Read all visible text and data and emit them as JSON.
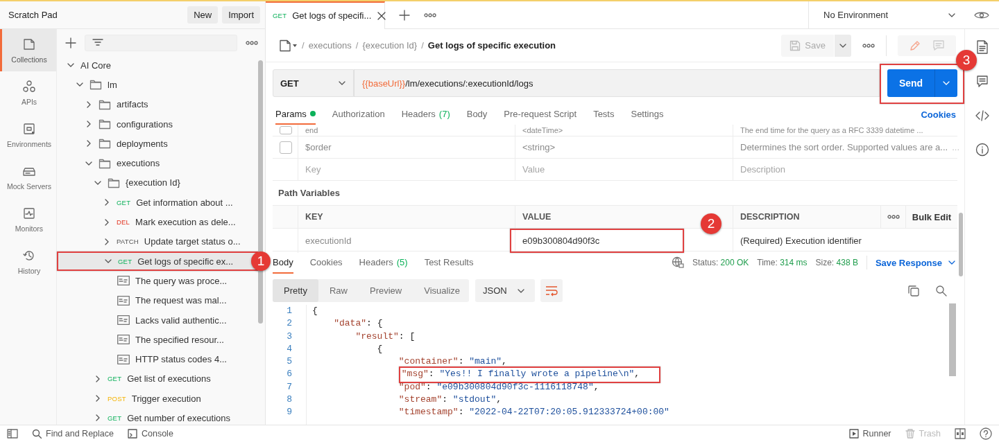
{
  "header": {
    "title": "Scratch Pad",
    "buttons": [
      "New",
      "Import"
    ]
  },
  "tabs": [
    {
      "method": "GET",
      "title": "Get logs of specifi...",
      "selected": true
    }
  ],
  "environment": {
    "value": "No Environment"
  },
  "nav": [
    {
      "label": "Collections",
      "selected": true
    },
    {
      "label": "APIs",
      "selected": false
    },
    {
      "label": "Environments",
      "selected": false
    },
    {
      "label": "Mock Servers",
      "selected": false
    },
    {
      "label": "Monitors",
      "selected": false
    },
    {
      "label": "History",
      "selected": false
    }
  ],
  "tree": [
    {
      "kind": "collection",
      "name": "AI Core",
      "expanded": true,
      "children": [
        {
          "kind": "folder",
          "name": "lm",
          "expanded": true,
          "children": [
            {
              "kind": "folder",
              "name": "artifacts",
              "expanded": false
            },
            {
              "kind": "folder",
              "name": "configurations",
              "expanded": false
            },
            {
              "kind": "folder",
              "name": "deployments",
              "expanded": false
            },
            {
              "kind": "folder",
              "name": "executions",
              "expanded": true,
              "children": [
                {
                  "kind": "folder",
                  "name": "{execution Id}",
                  "expanded": true,
                  "children": [
                    {
                      "kind": "request",
                      "method": "GET",
                      "name": "Get information about ...",
                      "expanded": false,
                      "selected": false
                    },
                    {
                      "kind": "request",
                      "method": "DEL",
                      "name": "Mark execution as dele...",
                      "expanded": false,
                      "selected": false
                    },
                    {
                      "kind": "request",
                      "method": "PATCH",
                      "name": "Update target status o...",
                      "expanded": false,
                      "selected": false
                    },
                    {
                      "kind": "request",
                      "method": "GET",
                      "name": "Get logs of specific ex...",
                      "expanded": true,
                      "selected": true,
                      "annotation": "1",
                      "children": [
                        {
                          "kind": "example",
                          "name": "The query was proce..."
                        },
                        {
                          "kind": "example",
                          "name": "The request was mal..."
                        },
                        {
                          "kind": "example",
                          "name": "Lacks valid authentic..."
                        },
                        {
                          "kind": "example",
                          "name": "The specified resour..."
                        },
                        {
                          "kind": "example",
                          "name": "HTTP status codes 4..."
                        }
                      ]
                    }
                  ]
                },
                {
                  "kind": "request",
                  "method": "GET",
                  "name": "Get list of executions",
                  "expanded": false,
                  "selected": false
                },
                {
                  "kind": "request",
                  "method": "POST",
                  "name": "Trigger execution",
                  "expanded": false,
                  "selected": false
                },
                {
                  "kind": "request",
                  "method": "GET",
                  "name": "Get number of executions",
                  "expanded": false,
                  "selected": false
                }
              ]
            }
          ]
        }
      ]
    }
  ],
  "request": {
    "breadcrumb": [
      {
        "kind": "separator",
        "text": "/"
      },
      {
        "kind": "link",
        "text": "executions"
      },
      {
        "kind": "separator",
        "text": "/"
      },
      {
        "kind": "link",
        "text": "{execution Id}"
      },
      {
        "kind": "separator",
        "text": "/"
      }
    ],
    "title": "Get logs of specific execution",
    "save_label": "Save",
    "method": "GET",
    "url": [
      {
        "text": "{{baseUrl}}",
        "kind": "variable"
      },
      {
        "text": "/lm/executions/:executionId/logs",
        "kind": "path"
      }
    ],
    "send": {
      "label": "Send",
      "annotation": "3"
    },
    "tabs": [
      {
        "label": "Params",
        "dot": true,
        "selected": true
      },
      {
        "label": "Authorization",
        "selected": false
      },
      {
        "label": "Headers",
        "count": "(7)",
        "selected": false
      },
      {
        "label": "Body",
        "selected": false
      },
      {
        "label": "Pre-request Script",
        "selected": false
      },
      {
        "label": "Tests",
        "selected": false
      },
      {
        "label": "Settings",
        "selected": false
      }
    ],
    "cookies_link": "Cookies"
  },
  "params": [
    {
      "kind": "param",
      "checked": false,
      "key": "end",
      "value": "<dateTime>",
      "description": "The end time for the query as a RFC 3339 datetime ..."
    },
    {
      "kind": "param",
      "checked": false,
      "key": "$order",
      "value": "<string>",
      "description": "Determines the sort order. Supported values are a...",
      "more": "..."
    },
    {
      "kind": "new",
      "key_placeholder": "Key",
      "value_placeholder": "Value",
      "description_placeholder": "Description"
    }
  ],
  "path_variables": {
    "title": "Path Variables",
    "columns": [
      "KEY",
      "VALUE",
      "DESCRIPTION"
    ],
    "bulk_edit": "Bulk Edit",
    "rows": [
      {
        "key": "executionId",
        "value": "e09b300804d90f3c",
        "description": "(Required) Execution identifier",
        "annotation": "2"
      }
    ]
  },
  "response": {
    "tabs": [
      {
        "label": "Body",
        "selected": true
      },
      {
        "label": "Cookies",
        "selected": false
      },
      {
        "label": "Headers",
        "count": "(5)",
        "selected": false
      },
      {
        "label": "Test Results",
        "selected": false
      }
    ],
    "stats": [
      {
        "label": "Status:",
        "value": "200 OK"
      },
      {
        "label": "Time:",
        "value": "314 ms"
      },
      {
        "label": "Size:",
        "value": "438 B"
      }
    ],
    "save": "Save Response",
    "modes": [
      {
        "label": "Pretty",
        "selected": true
      },
      {
        "label": "Raw",
        "selected": false
      },
      {
        "label": "Preview",
        "selected": false
      },
      {
        "label": "Visualize",
        "selected": false
      }
    ],
    "format": "JSON",
    "lines": [
      {
        "number": "1",
        "text": "{"
      },
      {
        "number": "2",
        "text": "    \"data\": {"
      },
      {
        "number": "3",
        "text": "        \"result\": ["
      },
      {
        "number": "4",
        "text": "            {"
      },
      {
        "number": "5",
        "text": "                \"container\": \"main\","
      },
      {
        "number": "6",
        "text": "                \"msg\": \"Yes!! I finally wrote a pipeline\\n\",",
        "highlighted": true
      },
      {
        "number": "7",
        "text": "                \"pod\": \"e09b300804d90f3c-1116118748\","
      },
      {
        "number": "8",
        "text": "                \"stream\": \"stdout\","
      },
      {
        "number": "9",
        "text": "                \"timestamp\": \"2022-04-22T07:20:05.912333724+00:00\""
      }
    ]
  },
  "status_bar": {
    "left": [
      {
        "label": "Find and Replace"
      },
      {
        "label": "Console"
      }
    ],
    "right": [
      {
        "label": "Runner",
        "disabled": false
      },
      {
        "label": "Trash",
        "disabled": true
      }
    ]
  }
}
